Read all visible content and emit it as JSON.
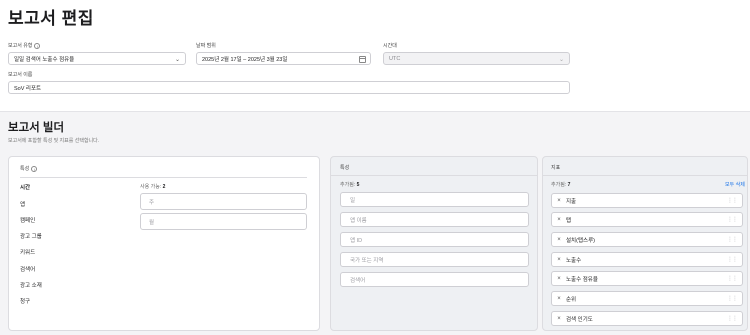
{
  "page": {
    "title": "보고서 편집"
  },
  "form": {
    "report_type": {
      "label": "보고서 유형",
      "value": "일일 검색어 노출수 점유율"
    },
    "date_range": {
      "label": "날짜 범위",
      "value": "2025년 2월 17일 – 2025년 3월 23일"
    },
    "timezone": {
      "label": "시간대",
      "value": "UTC"
    },
    "report_name": {
      "label": "보고서 이름",
      "value": "SoV 리포트"
    }
  },
  "builder": {
    "title": "보고서 빌더",
    "subtitle": "보고서에 포함할 특성 및 지표를 선택합니다.",
    "categories_panel": {
      "title": "특성",
      "items": [
        "시간",
        "앱",
        "캠페인",
        "광고 그룹",
        "키워드",
        "검색어",
        "광고 소재",
        "청구"
      ],
      "active_index": 0,
      "available_label": "사용 가능:",
      "available_count": "2",
      "options": [
        "주",
        "월"
      ]
    },
    "dimensions_panel": {
      "title": "특성",
      "added_label": "추가됨:",
      "added_count": "5",
      "items": [
        "일",
        "앱 이름",
        "앱 ID",
        "국가 또는 지역",
        "검색어"
      ]
    },
    "metrics_panel": {
      "title": "지표",
      "added_label": "추가됨:",
      "added_count": "7",
      "remove_all": "모두 삭제",
      "items": [
        "지출",
        "탭",
        "설치(탭스루)",
        "노출수",
        "노출수 점유율",
        "순위",
        "검색 인기도"
      ]
    }
  }
}
